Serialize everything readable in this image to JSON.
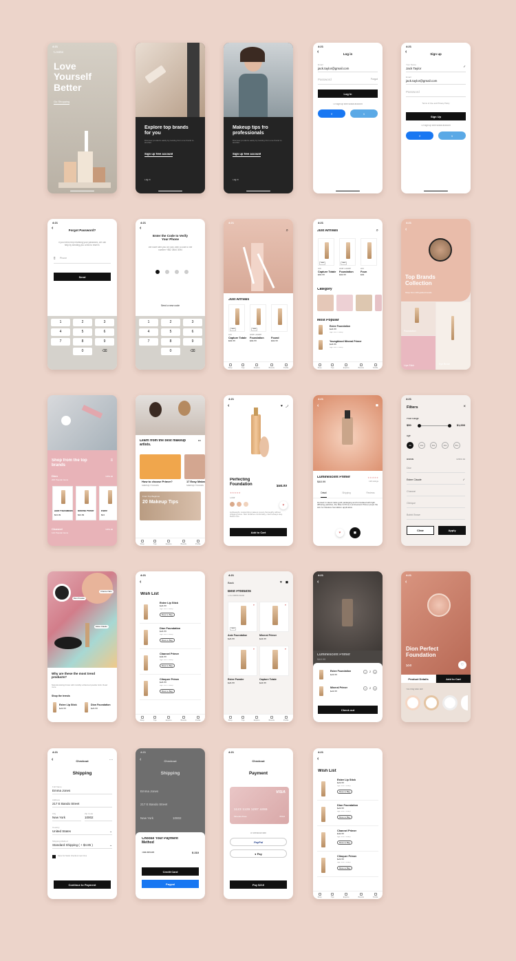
{
  "status_time": "4:21",
  "s1": {
    "logo": "Cosmo",
    "title": "Love Yourself Better",
    "cta": "Go Shopping"
  },
  "s2": {
    "title": "Explore top brands for you",
    "body": "Discover products easily by looking from one brand to another.",
    "cta": "Sign up free account",
    "login": "Log in"
  },
  "s3": {
    "title": "Makeup tips fro professionals",
    "body": "Discover products easily by looking from one brand to another.",
    "cta": "Sign up free account",
    "login": "Log in"
  },
  "s4": {
    "title": "Log in",
    "email_label": "Email",
    "email": "jack.taylor@gmail.com",
    "password": "Password",
    "forgot": "Forgot",
    "btn": "Log In",
    "social": "Or sign up with social account"
  },
  "s5": {
    "title": "Sign up",
    "name_label": "Your Name",
    "name": "Jack Taylor",
    "email_label": "Email",
    "email": "jack.taylor@gmail.com",
    "password": "Password",
    "terms": "Terms of Use and Privacy Policy",
    "btn": "Sign Up",
    "social": "Or sign up with social account"
  },
  "s6": {
    "title": "Forgot Password?",
    "body": "If you need help resetting your password, we can help by sending you a link to reset it.",
    "phone": "Phone",
    "btn": "Send",
    "keys": [
      "1",
      "2",
      "3",
      "4",
      "5",
      "6",
      "7",
      "8",
      "9",
      "0"
    ],
    "subs": [
      "",
      "ABC",
      "DEF",
      "GHI",
      "JKL",
      "MNO",
      "PQRS",
      "TUV",
      "WXYZ",
      ""
    ]
  },
  "s7": {
    "title": "Enter the Code to Verify Your Phone",
    "body": "We have sent you an SMS with a code to the number +852 3844 3094",
    "resend": "Send a new code"
  },
  "s8": {
    "section": "Just Arrivals",
    "tabs": [
      "Shop",
      "Tips",
      "Explore",
      "Brands",
      "Profile"
    ],
    "products": [
      {
        "brand": "Dio",
        "name": "Capture Totale",
        "price": "$44.99",
        "badge": "New"
      },
      {
        "brand": "Aste Lauder",
        "name": "Foundation",
        "price": "$44.99",
        "badge": "New"
      },
      {
        "brand": "",
        "name": "Found",
        "price": "$44.99",
        "badge": ""
      }
    ]
  },
  "s9": {
    "title": "Just Arrivals",
    "category": "Category",
    "popular": "Most Popular",
    "tabs": [
      "Shop",
      "Tips",
      "Explore",
      "Brands",
      "Profile"
    ],
    "products": [
      {
        "brand": "Dio",
        "name": "Capture Totale",
        "price": "$44.99",
        "badge": "New"
      },
      {
        "brand": "Aste Lauder",
        "name": "Foundation",
        "price": "$44.99",
        "badge": "New"
      },
      {
        "brand": "Ast",
        "name": "Foun",
        "price": "$44",
        "badge": ""
      }
    ],
    "popular_items": [
      {
        "name": "Estee Foundation",
        "price": "$24.99",
        "meta": "Age: 20s • Sharp"
      },
      {
        "name": "Youngblood Mineral Primer",
        "price": "$24.99",
        "meta": "Age: 20s • Sharp"
      }
    ]
  },
  "s10": {
    "title": "Top Brands Collection",
    "sub": "Shop from 200 global brands",
    "tiles": [
      "Foundation",
      "Lips Stick",
      "Eye Brush"
    ]
  },
  "s11": {
    "title": "Shop from the top brands",
    "brand1": "Dion",
    "brand1_sub": "206 Popular items",
    "brand2": "Channel",
    "brand2_sub": "124 Popular items",
    "view": "View all",
    "products": [
      {
        "name": "Aste Foundation",
        "price": "$24.99"
      },
      {
        "name": "Mineral Primer",
        "price": "$24.99"
      },
      {
        "name": "Estee",
        "price": "$24"
      }
    ]
  },
  "s12": {
    "title": "Learn from the best makeup artists.",
    "card1": "How to choose Primer?",
    "card1_sub": "Makeup Products",
    "card2": "17 Easy Makeup",
    "card2_sub": "Makeup Products",
    "banner_sub": "From Top Beginner",
    "banner": "20 Makeup Tips"
  },
  "s13": {
    "title": "Perfecting Foundation",
    "price": "$58.99",
    "color": "Color",
    "desc": "Lightweight, moisturizing makeup covers thoroughly without clogging pores. Skin breathes comfortably, colors always stay. Read more",
    "btn": "Add to Cart"
  },
  "s14": {
    "title": "Luminescent Primer",
    "price": "$48.99",
    "reviews": "120 ratings",
    "tabs": [
      "Detail",
      "Shipping",
      "Reviews"
    ],
    "desc": "Housed in sleek matte gold packaging and formulated with light diffusing particles, the Rise & Prime Luminescent Primer preps the skin for flawless foundation application."
  },
  "s15": {
    "title": "Filters",
    "price_label": "Price Range",
    "min": "$50",
    "max": "$1,000",
    "age_label": "Age",
    "ages": [
      "All",
      "20s",
      "30s",
      "40s",
      "50+"
    ],
    "brands_label": "Brands",
    "select_all": "Select all",
    "brands": [
      "Dion",
      "Estee Claude",
      "Channel",
      "Clinique",
      "Bobbi Brown"
    ],
    "clear": "Clear",
    "apply": "Apply"
  },
  "s16": {
    "tag1": "Channel Skin",
    "tag2": "Dion Powder",
    "tag3": "Estee Claude",
    "title": "Why are these the most trend products?",
    "body": "Natural-looking brows with invisibly enhanced powder stick. Read more",
    "shop": "Shop the trends",
    "items": [
      {
        "name": "Estee Lip Stick",
        "price": "$24.99"
      },
      {
        "name": "Dion Foundation",
        "price": "$24.99"
      }
    ]
  },
  "s17": {
    "title": "Wish List",
    "move": "Move to Bag",
    "meta": "Age: 20s • Sharp",
    "items": [
      {
        "name": "Estee Lip Stick",
        "price": "$24.99"
      },
      {
        "name": "Dion Foundation",
        "price": "$24.99"
      },
      {
        "name": "Channel Primer",
        "price": "$34.99"
      },
      {
        "name": "Clinquer Primer",
        "price": "$24.99"
      }
    ],
    "tabs": [
      "Shop",
      "Tips",
      "Explore",
      "Brands",
      "Profile"
    ]
  },
  "s18": {
    "back": "Back",
    "title": "Best Products",
    "sub": "1743 items found",
    "products": [
      {
        "name": "Aste Foundation",
        "price": "$24.99",
        "badge": "New"
      },
      {
        "name": "Mineral Primer",
        "price": "$24.99",
        "badge": ""
      },
      {
        "name": "Estee Powder",
        "price": "$24.99",
        "badge": ""
      },
      {
        "name": "Capture Totale",
        "price": "$24.99",
        "badge": ""
      }
    ],
    "tabs": [
      "Shop",
      "Tips",
      "Explore",
      "Brands",
      "Profile"
    ]
  },
  "s19": {
    "title": "Luminescent Primer",
    "price": "$48.99",
    "items": [
      {
        "name": "Estee Foundation",
        "price": "$24.99",
        "qty": "2"
      },
      {
        "name": "Mineral Primer",
        "price": "$24.99",
        "qty": "2"
      }
    ],
    "btn": "Check out"
  },
  "s20": {
    "title": "Dion Perfect Foundation",
    "price": "$58",
    "tabs": [
      "Product Details",
      "Add to Cart"
    ],
    "like": "You may also like"
  },
  "s21": {
    "title": "Checkout",
    "heading": "Shipping",
    "fields": [
      {
        "label": "Full Name",
        "value": "Emma Jones"
      },
      {
        "label": "Address",
        "value": "217 E Bando Street"
      }
    ],
    "city_label": "City",
    "city": "New York",
    "zip_label": "Zip Code",
    "zip": "10002",
    "country_label": "Country",
    "country": "United States",
    "method_label": "Shipping Method",
    "method": "Standard Shipping ( + $4.85 )",
    "save": "Save for faster checkout next time",
    "btn": "Continue to Payment"
  },
  "s22": {
    "title": "Checkout",
    "heading": "Shipping",
    "name": "Emma Jones",
    "address": "217 E Bando Street",
    "city": "New York",
    "zip": "10002",
    "sheet_title": "Choose Your Payment Method",
    "total_label": "Total amount",
    "total": "$ 210",
    "card": "Credit Card",
    "paypal": "Paypal"
  },
  "s23": {
    "title": "Checkout",
    "heading": "Payment",
    "card_brand": "VISA",
    "card_number": "1123  1129  1287  4455",
    "card_holder": "Miranda Rose",
    "card_exp": "05/24",
    "or": "or checkout with",
    "paypal": "PayPal",
    "apple": "Pay",
    "btn": "Pay $210"
  },
  "s24": {
    "title": "Wish List",
    "move": "Move to Bag",
    "meta": "Age: 20s • Sharp",
    "items": [
      {
        "name": "Estee Lip Stick",
        "price": "$24.99"
      },
      {
        "name": "Dion Foundation",
        "price": "$24.99"
      },
      {
        "name": "Channel Primer",
        "price": "$34.99"
      },
      {
        "name": "Clinquer Primer",
        "price": "$24.99"
      }
    ],
    "tabs": [
      "Shop",
      "Tips",
      "Explore",
      "Brands",
      "Profile"
    ]
  }
}
